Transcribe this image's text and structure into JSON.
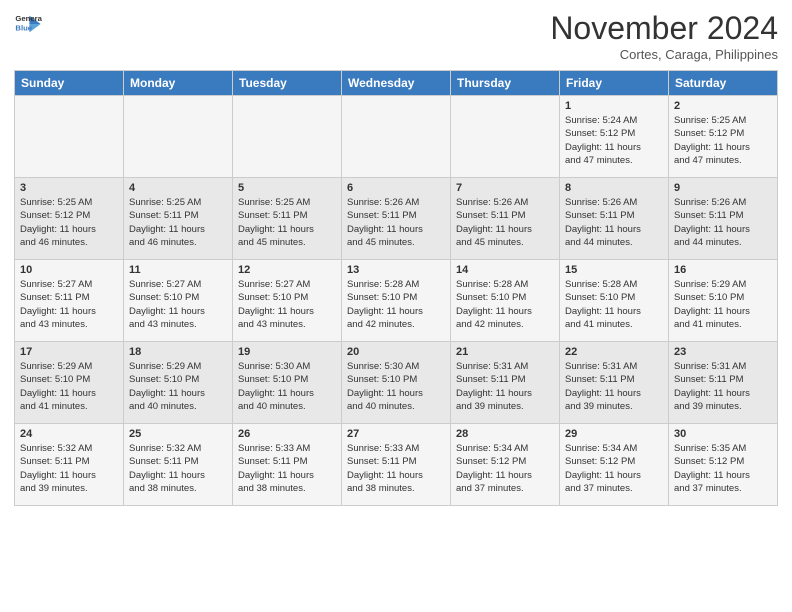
{
  "logo": {
    "line1": "General",
    "line2": "Blue"
  },
  "title": "November 2024",
  "location": "Cortes, Caraga, Philippines",
  "days_of_week": [
    "Sunday",
    "Monday",
    "Tuesday",
    "Wednesday",
    "Thursday",
    "Friday",
    "Saturday"
  ],
  "weeks": [
    [
      {
        "num": "",
        "info": ""
      },
      {
        "num": "",
        "info": ""
      },
      {
        "num": "",
        "info": ""
      },
      {
        "num": "",
        "info": ""
      },
      {
        "num": "",
        "info": ""
      },
      {
        "num": "1",
        "info": "Sunrise: 5:24 AM\nSunset: 5:12 PM\nDaylight: 11 hours\nand 47 minutes."
      },
      {
        "num": "2",
        "info": "Sunrise: 5:25 AM\nSunset: 5:12 PM\nDaylight: 11 hours\nand 47 minutes."
      }
    ],
    [
      {
        "num": "3",
        "info": "Sunrise: 5:25 AM\nSunset: 5:12 PM\nDaylight: 11 hours\nand 46 minutes."
      },
      {
        "num": "4",
        "info": "Sunrise: 5:25 AM\nSunset: 5:11 PM\nDaylight: 11 hours\nand 46 minutes."
      },
      {
        "num": "5",
        "info": "Sunrise: 5:25 AM\nSunset: 5:11 PM\nDaylight: 11 hours\nand 45 minutes."
      },
      {
        "num": "6",
        "info": "Sunrise: 5:26 AM\nSunset: 5:11 PM\nDaylight: 11 hours\nand 45 minutes."
      },
      {
        "num": "7",
        "info": "Sunrise: 5:26 AM\nSunset: 5:11 PM\nDaylight: 11 hours\nand 45 minutes."
      },
      {
        "num": "8",
        "info": "Sunrise: 5:26 AM\nSunset: 5:11 PM\nDaylight: 11 hours\nand 44 minutes."
      },
      {
        "num": "9",
        "info": "Sunrise: 5:26 AM\nSunset: 5:11 PM\nDaylight: 11 hours\nand 44 minutes."
      }
    ],
    [
      {
        "num": "10",
        "info": "Sunrise: 5:27 AM\nSunset: 5:11 PM\nDaylight: 11 hours\nand 43 minutes."
      },
      {
        "num": "11",
        "info": "Sunrise: 5:27 AM\nSunset: 5:10 PM\nDaylight: 11 hours\nand 43 minutes."
      },
      {
        "num": "12",
        "info": "Sunrise: 5:27 AM\nSunset: 5:10 PM\nDaylight: 11 hours\nand 43 minutes."
      },
      {
        "num": "13",
        "info": "Sunrise: 5:28 AM\nSunset: 5:10 PM\nDaylight: 11 hours\nand 42 minutes."
      },
      {
        "num": "14",
        "info": "Sunrise: 5:28 AM\nSunset: 5:10 PM\nDaylight: 11 hours\nand 42 minutes."
      },
      {
        "num": "15",
        "info": "Sunrise: 5:28 AM\nSunset: 5:10 PM\nDaylight: 11 hours\nand 41 minutes."
      },
      {
        "num": "16",
        "info": "Sunrise: 5:29 AM\nSunset: 5:10 PM\nDaylight: 11 hours\nand 41 minutes."
      }
    ],
    [
      {
        "num": "17",
        "info": "Sunrise: 5:29 AM\nSunset: 5:10 PM\nDaylight: 11 hours\nand 41 minutes."
      },
      {
        "num": "18",
        "info": "Sunrise: 5:29 AM\nSunset: 5:10 PM\nDaylight: 11 hours\nand 40 minutes."
      },
      {
        "num": "19",
        "info": "Sunrise: 5:30 AM\nSunset: 5:10 PM\nDaylight: 11 hours\nand 40 minutes."
      },
      {
        "num": "20",
        "info": "Sunrise: 5:30 AM\nSunset: 5:10 PM\nDaylight: 11 hours\nand 40 minutes."
      },
      {
        "num": "21",
        "info": "Sunrise: 5:31 AM\nSunset: 5:11 PM\nDaylight: 11 hours\nand 39 minutes."
      },
      {
        "num": "22",
        "info": "Sunrise: 5:31 AM\nSunset: 5:11 PM\nDaylight: 11 hours\nand 39 minutes."
      },
      {
        "num": "23",
        "info": "Sunrise: 5:31 AM\nSunset: 5:11 PM\nDaylight: 11 hours\nand 39 minutes."
      }
    ],
    [
      {
        "num": "24",
        "info": "Sunrise: 5:32 AM\nSunset: 5:11 PM\nDaylight: 11 hours\nand 39 minutes."
      },
      {
        "num": "25",
        "info": "Sunrise: 5:32 AM\nSunset: 5:11 PM\nDaylight: 11 hours\nand 38 minutes."
      },
      {
        "num": "26",
        "info": "Sunrise: 5:33 AM\nSunset: 5:11 PM\nDaylight: 11 hours\nand 38 minutes."
      },
      {
        "num": "27",
        "info": "Sunrise: 5:33 AM\nSunset: 5:11 PM\nDaylight: 11 hours\nand 38 minutes."
      },
      {
        "num": "28",
        "info": "Sunrise: 5:34 AM\nSunset: 5:12 PM\nDaylight: 11 hours\nand 37 minutes."
      },
      {
        "num": "29",
        "info": "Sunrise: 5:34 AM\nSunset: 5:12 PM\nDaylight: 11 hours\nand 37 minutes."
      },
      {
        "num": "30",
        "info": "Sunrise: 5:35 AM\nSunset: 5:12 PM\nDaylight: 11 hours\nand 37 minutes."
      }
    ]
  ]
}
